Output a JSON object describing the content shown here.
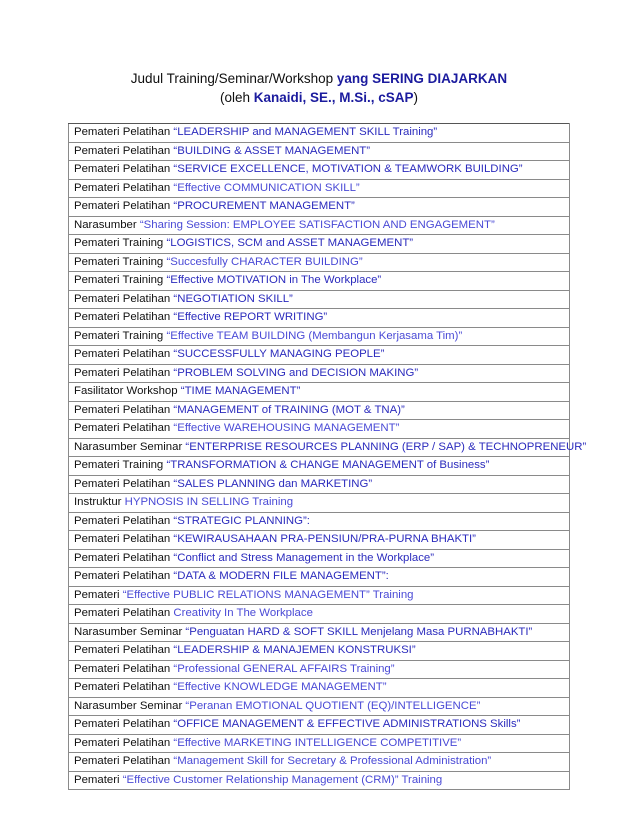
{
  "document": {
    "title_line1_plain": "Judul Training/Seminar/Workshop ",
    "title_line1_accent": "yang SERING DIAJARKAN",
    "title_line2_open": "(oleh ",
    "title_line2_accent": "Kanaidi, SE., M.Si., cSAP",
    "title_line2_close": ")",
    "accent_color": "#1b1b9e",
    "title_color": "#2b2bbd",
    "text_color": "#111111",
    "border_color": "#8a8a8a"
  },
  "table": {
    "rows": [
      {
        "prefix": "Pemateri Pelatihan ",
        "title": "“LEADERSHIP and MANAGEMENT  SKILL Training”",
        "shade": "normal"
      },
      {
        "prefix": "Pemateri Pelatihan ",
        "title": "“BUILDING  & ASSET MANAGEMENT”",
        "shade": "normal"
      },
      {
        "prefix": "Pemateri Pelatihan ",
        "title": "“SERVICE EXCELLENCE, MOTIVATION   & TEAMWORK BUILDING”",
        "shade": "normal"
      },
      {
        "prefix": "Pemateri Pelatihan ",
        "title": "“Effective COMMUNICATION  SKILL”",
        "shade": "soft"
      },
      {
        "prefix": "Pemateri Pelatihan ",
        "title": "“PROCUREMENT MANAGEMENT”",
        "shade": "normal"
      },
      {
        "prefix": "Narasumber ",
        "title": "“Sharing Session: EMPLOYEE SATISFACTION AND ENGAGEMENT”",
        "shade": "soft"
      },
      {
        "prefix": "Pemateri Training ",
        "title": "“LOGISTICS, SCM and ASSET MANAGEMENT”",
        "shade": "normal"
      },
      {
        "prefix": "Pemateri  Training ",
        "title": "“Succesfully CHARACTER  BUILDING”",
        "shade": "soft"
      },
      {
        "prefix": "Pemateri Training ",
        "title": "“Effective MOTIVATION  in The Workplace”",
        "shade": "normal"
      },
      {
        "prefix": "Pemateri Pelatihan ",
        "title": "“NEGOTIATION SKILL”",
        "shade": "normal"
      },
      {
        "prefix": "Pemateri Pelatihan ",
        "title": "“Effective REPORT WRITING”",
        "shade": "normal"
      },
      {
        "prefix": "Pemateri Training ",
        "title": "“Effective TEAM BUILDING  (Membangun Kerjasama Tim)”",
        "shade": "soft"
      },
      {
        "prefix": "Pemateri Pelatihan ",
        "title": "“SUCCESSFULLY MANAGING  PEOPLE”",
        "shade": "normal"
      },
      {
        "prefix": "Pemateri Pelatihan ",
        "title": "“PROBLEM SOLVING and DECISION MAKING”",
        "shade": "normal"
      },
      {
        "prefix": "Fasilitator Workshop ",
        "title": "“TIME MANAGEMENT”",
        "shade": "normal"
      },
      {
        "prefix": "Pemateri Pelatihan ",
        "title": "“MANAGEMENT  of TRAINING  (MOT & TNA)”",
        "shade": "normal"
      },
      {
        "prefix": "Pemateri Pelatihan ",
        "title": "“Effective WAREHOUSING MANAGEMENT”",
        "shade": "soft"
      },
      {
        "prefix": "Narasumber Seminar ",
        "title": "“ENTERPRISE RESOURCES PLANNING  (ERP / SAP) & TECHNOPRENEUR”",
        "shade": "normal"
      },
      {
        "prefix": "Pemateri Training ",
        "title": "“TRANSFORMATION  & CHANGE MANAGEMENT  of Business”",
        "shade": "normal"
      },
      {
        "prefix": "Pemateri Pelatihan ",
        "title": "“SALES PLANNING  dan MARKETING”",
        "shade": "normal"
      },
      {
        "prefix": "Instruktur ",
        "title": "HYPNOSIS IN SELLING  Training",
        "shade": "soft"
      },
      {
        "prefix": "Pemateri Pelatihan ",
        "title": "“STRATEGIC PLANNING”:",
        "shade": "normal"
      },
      {
        "prefix": "Pemateri Pelatihan ",
        "title": "“KEWIRAUSAHAAN  PRA-PENSIUN/PRA-PURNA  BHAKTI”",
        "shade": "normal"
      },
      {
        "prefix": "Pemateri Pelatihan ",
        "title": "“Conflict and Stress Management in the Workplace”",
        "shade": "normal"
      },
      {
        "prefix": "Pemateri Pelatihan ",
        "title": "“DATA & MODERN FILE MANAGEMENT”:",
        "shade": "normal"
      },
      {
        "prefix": "Pemateri ",
        "title": "“Effective PUBLIC  RELATIONS MANAGEMENT”  Training",
        "shade": "soft"
      },
      {
        "prefix": "Pemateri Pelatihan ",
        "title": "Creativity In The Workplace",
        "shade": "soft"
      },
      {
        "prefix": "Narasumber Seminar ",
        "title": "“Penguatan HARD & SOFT SKILL Menjelang Masa PURNABHAKTI”",
        "shade": "normal"
      },
      {
        "prefix": "Pemateri Pelatihan ",
        "title": "“LEADERSHIP & MANAJEMEN  KONSTRUKSI”",
        "shade": "normal"
      },
      {
        "prefix": "Pemateri Pelatihan ",
        "title": "“Professional GENERAL AFFAIRS  Training”",
        "shade": "soft"
      },
      {
        "prefix": "Pemateri Pelatihan ",
        "title": "“Effective KNOWLEDGE MANAGEMENT”",
        "shade": "soft"
      },
      {
        "prefix": "Narasumber Seminar ",
        "title": "“Peranan EMOTIONAL QUOTIENT (EQ)/INTELLIGENCE”",
        "shade": "soft"
      },
      {
        "prefix": "Pemateri Pelatihan ",
        "title": "“OFFICE MANAGEMENT  & EFFECTIVE ADMINISTRATIONS  Skills”",
        "shade": "normal"
      },
      {
        "prefix": "Pemateri Pelatihan ",
        "title": "“Effective MARKETING  INTELLIGENCE  COMPETITIVE”",
        "shade": "soft"
      },
      {
        "prefix": "Pemateri Pelatihan ",
        "title": "“Management Skill for Secretary & Professional Administration”",
        "shade": "soft"
      },
      {
        "prefix": "Pemateri ",
        "title": "“Effective Customer Relationship Management  (CRM)” Training",
        "shade": "soft"
      }
    ]
  }
}
